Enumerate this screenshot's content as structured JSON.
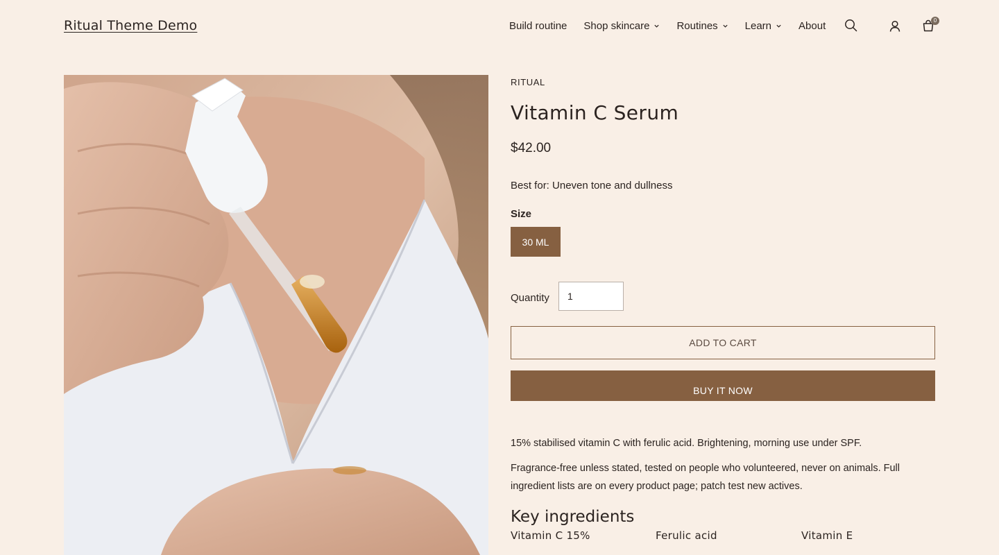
{
  "header": {
    "logo": "Ritual Theme Demo",
    "nav": [
      {
        "label": "Build routine",
        "dropdown": false
      },
      {
        "label": "Shop skincare",
        "dropdown": true
      },
      {
        "label": "Routines",
        "dropdown": true
      },
      {
        "label": "Learn",
        "dropdown": true
      },
      {
        "label": "About",
        "dropdown": false
      }
    ],
    "icons": [
      "search-icon",
      "account-icon",
      "cart-icon"
    ],
    "cart_count": "0"
  },
  "product": {
    "vendor": "RITUAL",
    "title": "Vitamin C Serum",
    "price": "$42.00",
    "best_for": "Best for: Uneven tone and dullness",
    "size_label": "Size",
    "size_selected": "30 ML",
    "quantity_label": "Quantity",
    "quantity_value": "1",
    "add_to_cart": "ADD TO CART",
    "buy_now": "BUY IT NOW",
    "description_1": "15% stabilised vitamin C with ferulic acid. Brightening, morning use under SPF.",
    "description_2": "Fragrance-free unless stated, tested on people who volunteered, never on animals. Full ingredient lists are on every product page; patch test new actives.",
    "key_ingredients_heading": "Key ingredients",
    "key_ingredients": [
      "Vitamin C 15%",
      "Ferulic acid",
      "Vitamin E"
    ]
  },
  "colors": {
    "background": "#f9efe6",
    "accent": "#866041",
    "text": "#2b2320"
  }
}
